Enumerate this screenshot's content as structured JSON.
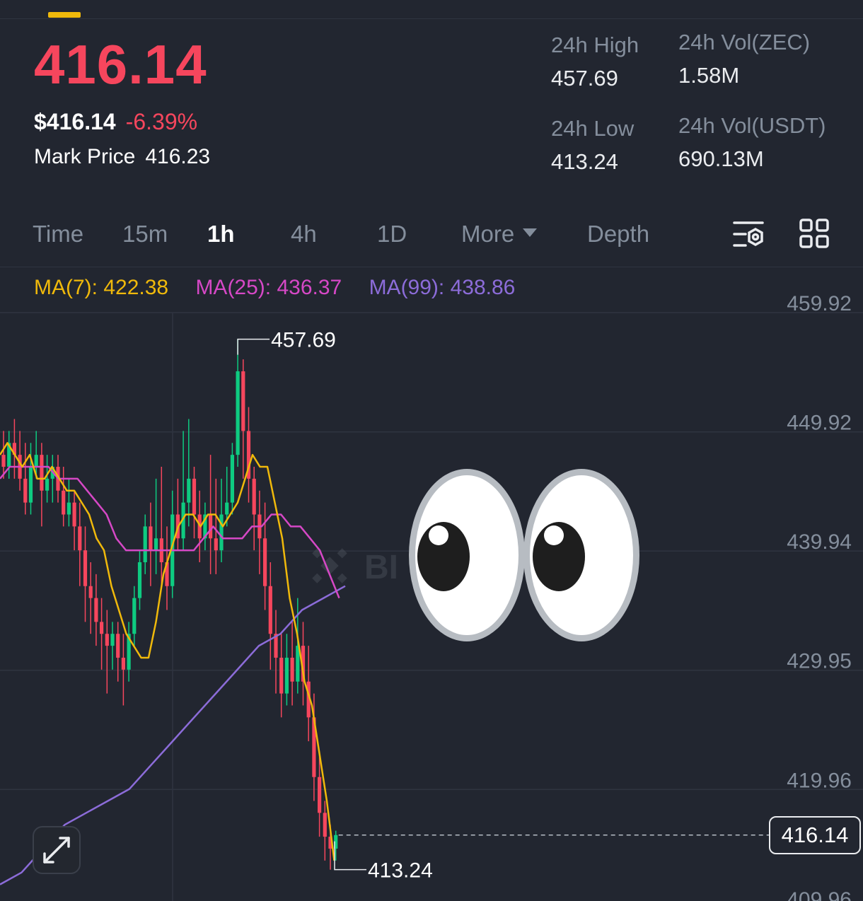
{
  "header": {
    "last_price": "416.14",
    "usd_price": "$416.14",
    "change_pct": "-6.39%",
    "mark_price_label": "Mark Price",
    "mark_price_value": "416.23"
  },
  "stats": {
    "high_label": "24h High",
    "high_value": "457.69",
    "low_label": "24h Low",
    "low_value": "413.24",
    "vol_base_label": "24h Vol(ZEC)",
    "vol_base_value": "1.58M",
    "vol_quote_label": "24h Vol(USDT)",
    "vol_quote_value": "690.13M"
  },
  "tabs": {
    "time": "Time",
    "m15": "15m",
    "h1": "1h",
    "h4": "4h",
    "d1": "1D",
    "more": "More",
    "depth": "Depth",
    "active": "1h"
  },
  "icons": {
    "settings": "chart-settings-icon",
    "layout": "grid-layout-icon",
    "expand": "expand-arrows-icon",
    "eyes": "eyes-emoji"
  },
  "ma": {
    "ma7": "MA(7): 422.38",
    "ma25": "MA(25): 436.37",
    "ma99": "MA(99): 438.86"
  },
  "colors": {
    "up": "#0ecb81",
    "down": "#f6465d",
    "ma7": "#f0b90b",
    "ma25": "#d648c6",
    "ma99": "#8c6cd9",
    "background": "#222630"
  },
  "chart_data": {
    "type": "candlestick",
    "y_ticks": [
      "459.92",
      "449.92",
      "439.94",
      "429.95",
      "419.96",
      "409.96"
    ],
    "ylim": [
      409.96,
      459.92
    ],
    "high_marker": "457.69",
    "low_marker": "413.24",
    "current_price": "416.14",
    "grid": true,
    "ma7": [
      448,
      449,
      448,
      447,
      448,
      446,
      446,
      447,
      446,
      445,
      445,
      444,
      443,
      441,
      440,
      437,
      435,
      433,
      432,
      431,
      431,
      434,
      438,
      440,
      442,
      443,
      443,
      442,
      443,
      443,
      442,
      443,
      444,
      446,
      448,
      447,
      447,
      444,
      441,
      436,
      433,
      429,
      427,
      423,
      419,
      414
    ],
    "ma25": [
      446,
      447,
      447,
      447,
      447,
      447,
      446,
      446,
      446,
      445,
      444,
      443,
      441,
      440,
      440,
      440,
      440,
      440,
      440,
      440,
      440,
      441,
      442,
      441,
      441,
      441,
      442,
      442,
      443,
      443,
      442,
      442,
      441,
      440,
      438,
      436
    ],
    "ma99": [
      412,
      413,
      415,
      417,
      418,
      419,
      420,
      422,
      424,
      426,
      428,
      430,
      432,
      433,
      435,
      436,
      437
    ],
    "candles": [
      [
        448,
        447,
        450,
        446
      ],
      [
        447,
        449,
        450,
        446
      ],
      [
        449,
        448,
        451,
        446
      ],
      [
        448,
        446,
        450,
        445
      ],
      [
        446,
        444,
        449,
        443
      ],
      [
        444,
        447,
        449,
        443
      ],
      [
        447,
        448,
        450,
        446
      ],
      [
        448,
        445,
        449,
        442
      ],
      [
        445,
        446,
        448,
        444
      ],
      [
        446,
        447,
        448,
        444
      ],
      [
        447,
        445,
        448,
        444
      ],
      [
        445,
        443,
        447,
        442
      ],
      [
        443,
        444,
        446,
        442
      ],
      [
        444,
        442,
        445,
        440
      ],
      [
        442,
        440,
        444,
        437
      ],
      [
        440,
        437,
        442,
        434
      ],
      [
        437,
        436,
        439,
        433
      ],
      [
        436,
        434,
        438,
        432
      ],
      [
        434,
        433,
        436,
        430
      ],
      [
        433,
        432,
        435,
        428
      ],
      [
        432,
        433,
        434,
        430
      ],
      [
        433,
        431,
        434,
        429
      ],
      [
        431,
        430,
        433,
        427
      ],
      [
        430,
        433,
        434,
        429
      ],
      [
        433,
        436,
        437,
        432
      ],
      [
        436,
        439,
        440,
        435
      ],
      [
        439,
        442,
        443,
        438
      ],
      [
        442,
        440,
        444,
        437
      ],
      [
        440,
        441,
        446,
        438
      ],
      [
        441,
        439,
        447,
        437
      ],
      [
        439,
        437,
        442,
        435
      ],
      [
        437,
        443,
        445,
        436
      ],
      [
        443,
        441,
        446,
        440
      ],
      [
        441,
        444,
        450,
        440
      ],
      [
        444,
        446,
        451,
        442
      ],
      [
        446,
        443,
        447,
        441
      ],
      [
        443,
        441,
        445,
        439
      ],
      [
        441,
        443,
        444,
        440
      ],
      [
        443,
        441,
        448,
        438
      ],
      [
        441,
        440,
        446,
        438
      ],
      [
        440,
        443,
        446,
        439
      ],
      [
        443,
        444,
        447,
        442
      ],
      [
        444,
        448,
        449,
        443
      ],
      [
        448,
        455,
        457.69,
        447
      ],
      [
        455,
        450,
        456,
        446
      ],
      [
        450,
        446,
        452,
        444
      ],
      [
        446,
        443,
        447,
        440
      ],
      [
        443,
        441,
        445,
        438
      ],
      [
        441,
        437,
        444,
        435
      ],
      [
        437,
        433,
        439,
        430
      ],
      [
        433,
        431,
        435,
        428
      ],
      [
        431,
        428,
        433,
        426
      ],
      [
        428,
        431,
        433,
        427
      ],
      [
        431,
        429,
        434,
        427
      ],
      [
        429,
        432,
        436,
        428
      ],
      [
        432,
        429,
        434,
        427
      ],
      [
        429,
        426,
        432,
        424
      ],
      [
        426,
        421,
        428,
        419
      ],
      [
        421,
        418,
        423,
        416
      ],
      [
        418,
        416,
        419,
        414
      ],
      [
        416,
        415,
        417,
        413.24
      ],
      [
        415,
        416.14,
        416.5,
        414
      ]
    ]
  }
}
